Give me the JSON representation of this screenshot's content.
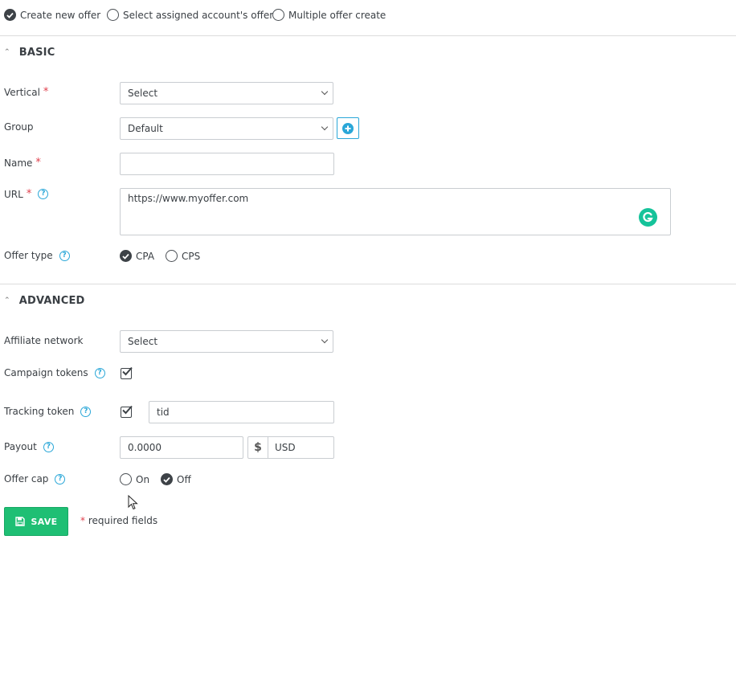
{
  "mode_options": [
    {
      "label": "Create new offer",
      "checked": true
    },
    {
      "label": "Select assigned account's offer",
      "checked": false
    },
    {
      "label": "Multiple offer create",
      "checked": false
    }
  ],
  "basic": {
    "title": "BASIC",
    "vertical": {
      "label": "Vertical",
      "required": "*",
      "value": "Select"
    },
    "group": {
      "label": "Group",
      "value": "Default"
    },
    "name": {
      "label": "Name",
      "required": "*",
      "value": ""
    },
    "url": {
      "label": "URL",
      "required": "*",
      "value": "https://www.myoffer.com"
    },
    "offer_type": {
      "label": "Offer type",
      "options": [
        {
          "label": "CPA",
          "checked": true
        },
        {
          "label": "CPS",
          "checked": false
        }
      ]
    }
  },
  "advanced": {
    "title": "ADVANCED",
    "affiliate_network": {
      "label": "Affiliate network",
      "value": "Select"
    },
    "campaign_tokens": {
      "label": "Campaign tokens",
      "checked": true
    },
    "tracking_token": {
      "label": "Tracking token",
      "checked": true,
      "value": "tid"
    },
    "payout": {
      "label": "Payout",
      "value": "0.0000",
      "currency_symbol": "$",
      "currency": "USD"
    },
    "offer_cap": {
      "label": "Offer cap",
      "options": [
        {
          "label": "On",
          "checked": false
        },
        {
          "label": "Off",
          "checked": true
        }
      ]
    }
  },
  "footer": {
    "save_label": "SAVE",
    "required_star": "*",
    "required_note": "required fields"
  },
  "help_glyph": "?",
  "colors": {
    "accent": "#2aa7d8",
    "save": "#1fbf74",
    "required": "#e0414d",
    "grammarly": "#15c39a"
  }
}
